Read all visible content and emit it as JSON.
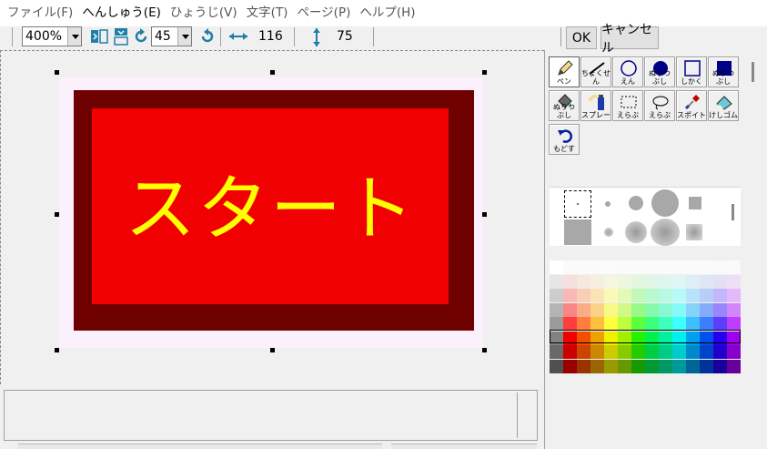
{
  "menu": {
    "items": [
      {
        "label": "ファイル(F)"
      },
      {
        "label": "へんしゅう(E)"
      },
      {
        "label": "ひょうじ(V)"
      },
      {
        "label": "文字(T)"
      },
      {
        "label": "ページ(P)"
      },
      {
        "label": "ヘルプ(H)"
      }
    ]
  },
  "toolbar": {
    "zoom_value": "400%",
    "angle_value": "45",
    "width_value": "116",
    "height_value": "75",
    "ok_label": "OK",
    "cancel_label": "キャンセル"
  },
  "canvas": {
    "text": "スタート",
    "colors": {
      "border_light": "#fbf0fb",
      "border_dark": "#6e0000",
      "fill": "#f00000",
      "text": "#ffff00"
    }
  },
  "tools": [
    {
      "name": "pen",
      "label": "ペン",
      "icon": "pencil-icon"
    },
    {
      "name": "line",
      "label": "ちょくせん",
      "icon": "line-icon"
    },
    {
      "name": "circle",
      "label": "えん",
      "icon": "circle-outline-icon"
    },
    {
      "name": "circle-fill",
      "label": "ぬりつぶし",
      "icon": "circle-filled-icon"
    },
    {
      "name": "rect",
      "label": "しかく",
      "icon": "square-outline-icon"
    },
    {
      "name": "rect-fill",
      "label": "ぬりつぶし",
      "icon": "square-filled-icon"
    },
    {
      "name": "bucket",
      "label": "ぬりつぶし",
      "icon": "paint-bucket-icon"
    },
    {
      "name": "spray",
      "label": "スプレー",
      "icon": "spray-icon"
    },
    {
      "name": "select-rect",
      "label": "えらぶ",
      "icon": "rect-select-icon"
    },
    {
      "name": "select-lasso",
      "label": "えらぶ",
      "icon": "lasso-select-icon"
    },
    {
      "name": "eyedropper",
      "label": "スポイト",
      "icon": "eyedropper-icon"
    },
    {
      "name": "eraser",
      "label": "けしゴム",
      "icon": "eraser-icon"
    },
    {
      "name": "undo",
      "label": "もどす",
      "icon": "undo-icon"
    }
  ]
}
